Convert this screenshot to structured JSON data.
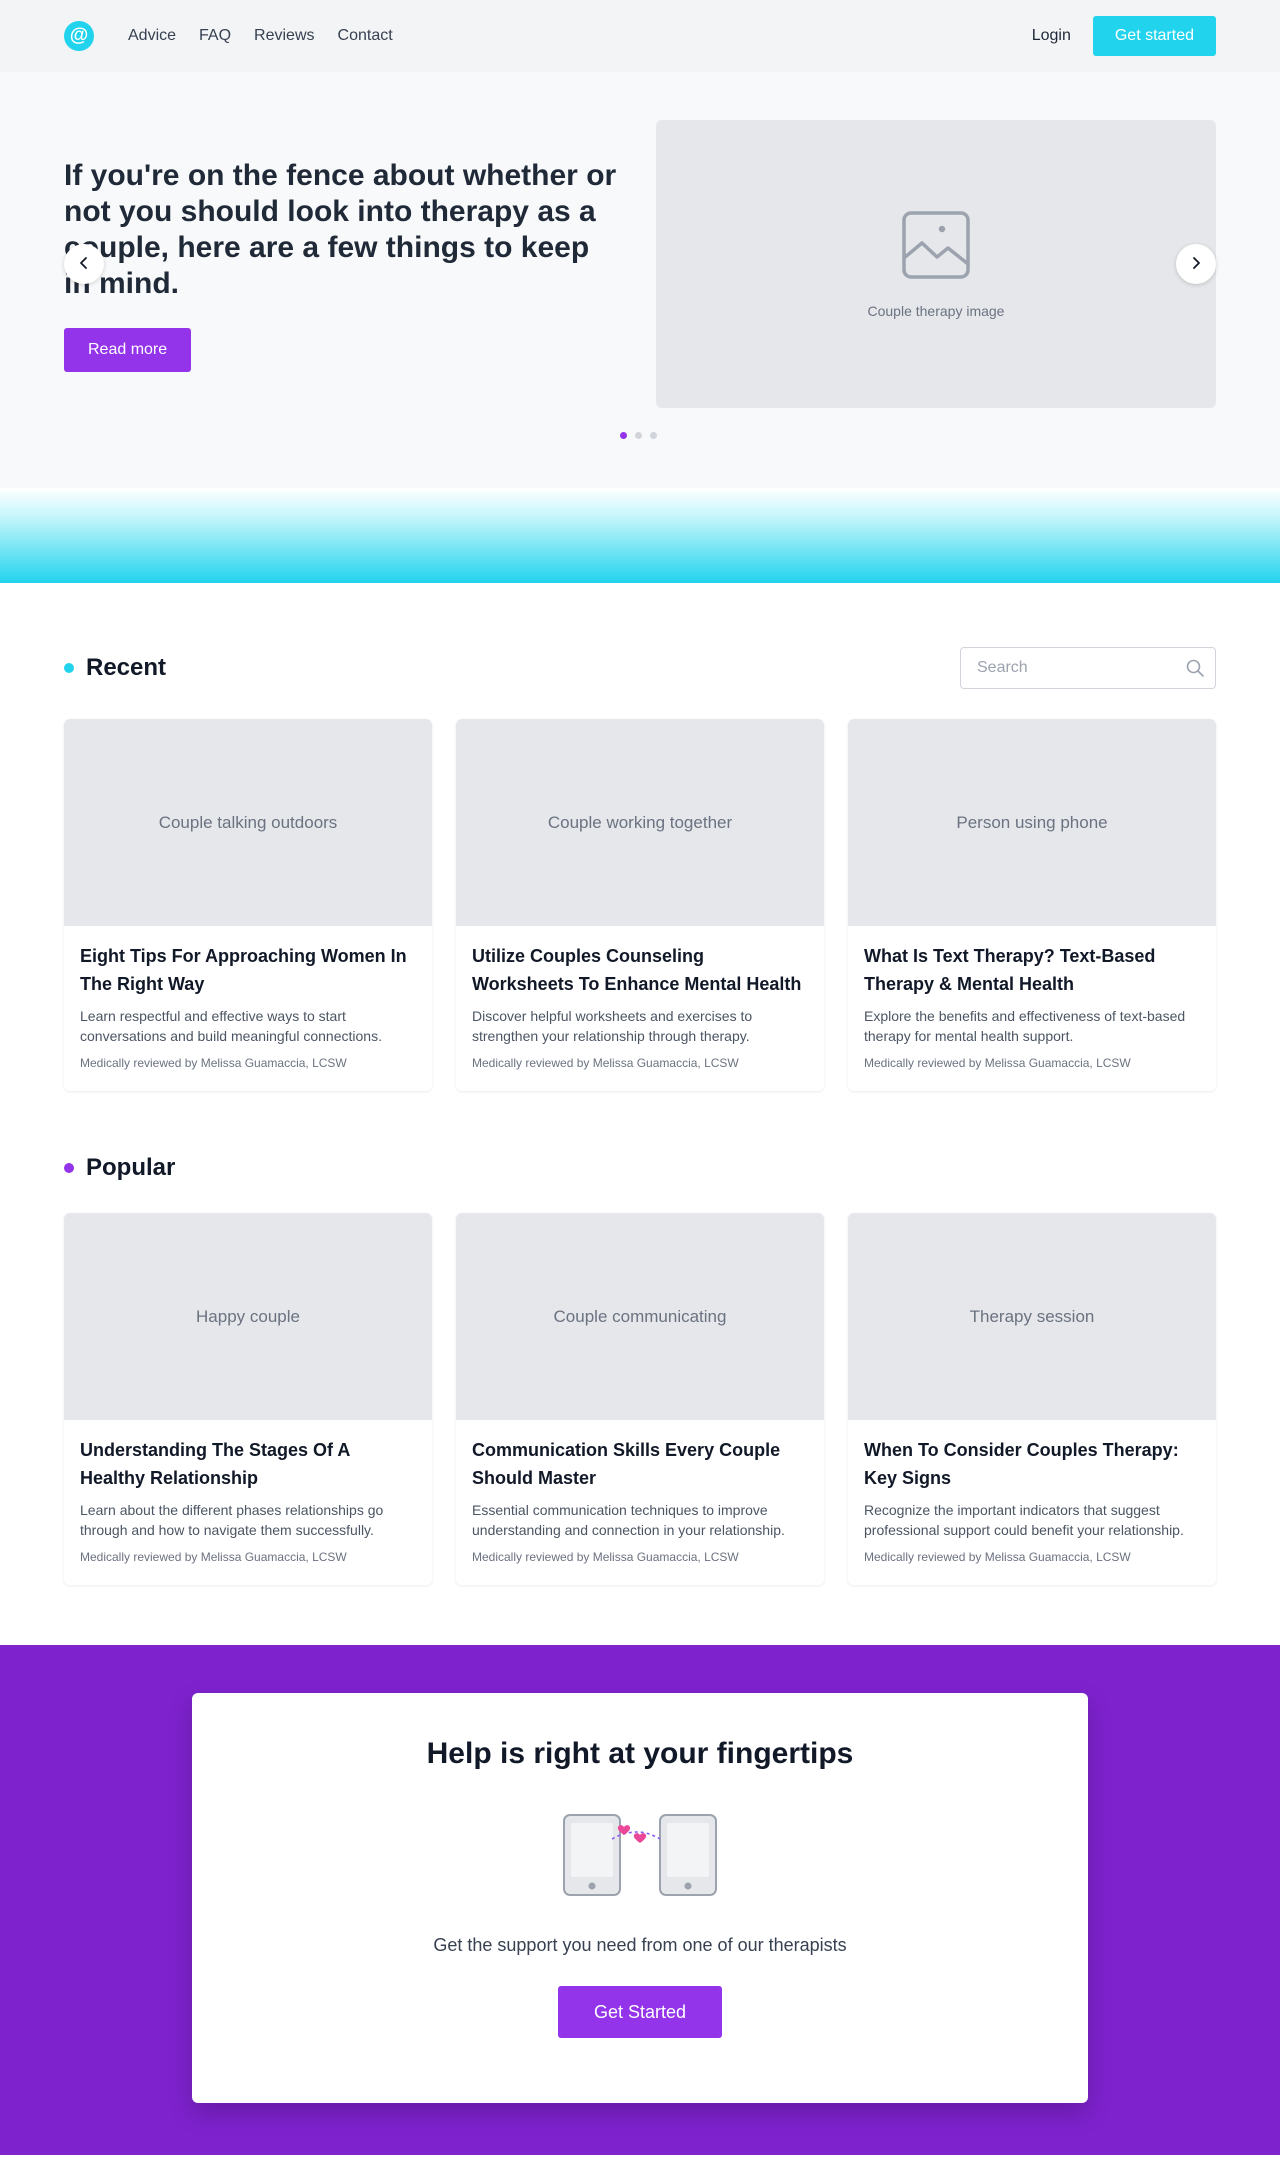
{
  "nav": {
    "logo_char": "@",
    "links": [
      "Advice",
      "FAQ",
      "Reviews",
      "Contact"
    ],
    "login_label": "Login",
    "cta_label": "Get started"
  },
  "hero": {
    "title": "If you're on the fence about whether or not you should look into therapy as a couple, here are a few things to keep in mind.",
    "button_label": "Read more",
    "image_caption": "Couple therapy image",
    "slides_total": 3,
    "active_slide": 1
  },
  "recent": {
    "title": "Recent",
    "bullet_color": "#22d3ee",
    "search_placeholder": "Search",
    "cards": [
      {
        "image_label": "Couple talking outdoors",
        "title": "Eight Tips For Approaching Women In The Right Way",
        "description": "Learn respectful and effective ways to start conversations and build meaningful connections.",
        "meta": "Medically reviewed by Melissa Guamaccia, LCSW"
      },
      {
        "image_label": "Couple working together",
        "title": "Utilize Couples Counseling Worksheets To Enhance Mental Health",
        "description": "Discover helpful worksheets and exercises to strengthen your relationship through therapy.",
        "meta": "Medically reviewed by Melissa Guamaccia, LCSW"
      },
      {
        "image_label": "Person using phone",
        "title": "What Is Text Therapy? Text-Based Therapy & Mental Health",
        "description": "Explore the benefits and effectiveness of text-based therapy for mental health support.",
        "meta": "Medically reviewed by Melissa Guamaccia, LCSW"
      }
    ]
  },
  "popular": {
    "title": "Popular",
    "bullet_color": "#9333ea",
    "cards": [
      {
        "image_label": "Happy couple",
        "title": "Understanding The Stages Of A Healthy Relationship",
        "description": "Learn about the different phases relationships go through and how to navigate them successfully.",
        "meta": "Medically reviewed by Melissa Guamaccia, LCSW"
      },
      {
        "image_label": "Couple communicating",
        "title": "Communication Skills Every Couple Should Master",
        "description": "Essential communication techniques to improve understanding and connection in your relationship.",
        "meta": "Medically reviewed by Melissa Guamaccia, LCSW"
      },
      {
        "image_label": "Therapy session",
        "title": "When To Consider Couples Therapy: Key Signs",
        "description": "Recognize the important indicators that suggest professional support could benefit your relationship.",
        "meta": "Medically reviewed by Melissa Guamaccia, LCSW"
      }
    ]
  },
  "cta": {
    "title": "Help is right at your fingertips",
    "text": "Get the support you need from one of our therapists",
    "button_label": "Get Started"
  },
  "colors": {
    "accent_cyan": "#22d3ee",
    "accent_purple": "#9333ea",
    "cta_background": "#7e22ce"
  },
  "icons": [
    "image-placeholder-icon",
    "chevron-left-icon",
    "chevron-right-icon",
    "search-icon",
    "phones-hearts-illustration"
  ]
}
